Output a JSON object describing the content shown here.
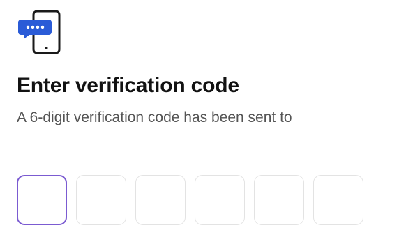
{
  "header": {
    "icon": "phone-message-icon",
    "title": "Enter verification code",
    "subtitle": "A 6-digit verification code has been sent to"
  },
  "code_input": {
    "length": 6,
    "values": [
      "",
      "",
      "",
      "",
      "",
      ""
    ],
    "active_index": 0,
    "active_border_color": "#7b5bd1",
    "inactive_border_color": "#e3e3e3"
  },
  "colors": {
    "accent_blue": "#2a5bd7",
    "title_text": "#121212",
    "subtitle_text": "#545454"
  }
}
